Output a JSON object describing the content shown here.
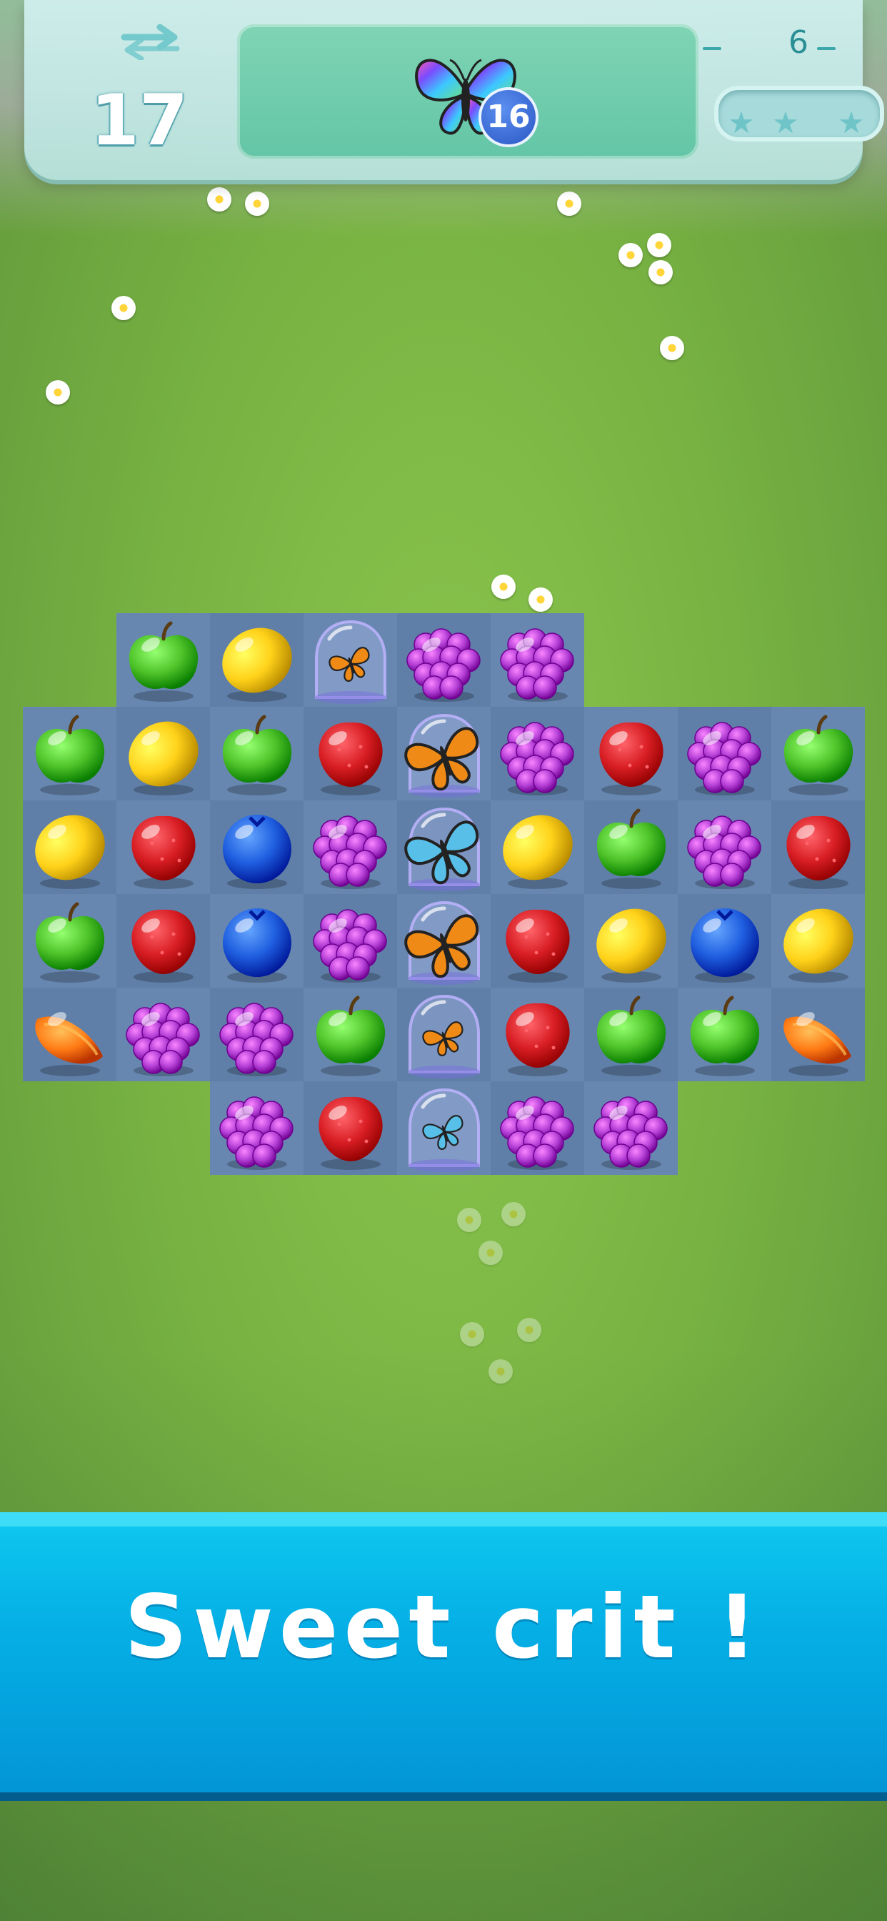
{
  "hud": {
    "moves_icon": "swap-arrows-icon",
    "moves_left": "17",
    "goal": {
      "icon": "rainbow-butterfly-icon",
      "remaining": "16"
    },
    "level": "6",
    "stars": {
      "earned": 0,
      "total": 3
    }
  },
  "board": {
    "columns": 9,
    "rows": 6,
    "pieces": [
      [
        null,
        "apple",
        "lemon",
        "butterfly-dome",
        "grape",
        "grape",
        null,
        null,
        null
      ],
      [
        "apple",
        "lemon",
        "apple",
        "strawberry",
        "butterfly-dome",
        "grape",
        "strawberry",
        "grape",
        "apple"
      ],
      [
        "lemon",
        "strawberry",
        "blueberry",
        "grape",
        "butterfly-dome",
        "lemon",
        "apple",
        "grape",
        "strawberry"
      ],
      [
        "apple",
        "strawberry",
        "blueberry",
        "grape",
        "butterfly-dome",
        "strawberry",
        "lemon",
        "blueberry",
        "lemon"
      ],
      [
        "orange",
        "grape",
        "grape",
        "apple",
        "butterfly-dome",
        "strawberry",
        "apple",
        "apple",
        "orange"
      ],
      [
        null,
        null,
        "grape",
        "strawberry",
        "butterfly-dome",
        "grape",
        "grape",
        null,
        null
      ]
    ],
    "colors": {
      "apple": "#4fc42a",
      "lemon": "#ffd21a",
      "strawberry": "#d81e24",
      "blueberry": "#1f5fe0",
      "grape": "#b43fd6",
      "orange": "#ff7a14",
      "butterfly_orange": "#f08a16",
      "butterfly_rainbow": "#58c0e8"
    }
  },
  "banner": {
    "text": "Sweet crit !"
  }
}
